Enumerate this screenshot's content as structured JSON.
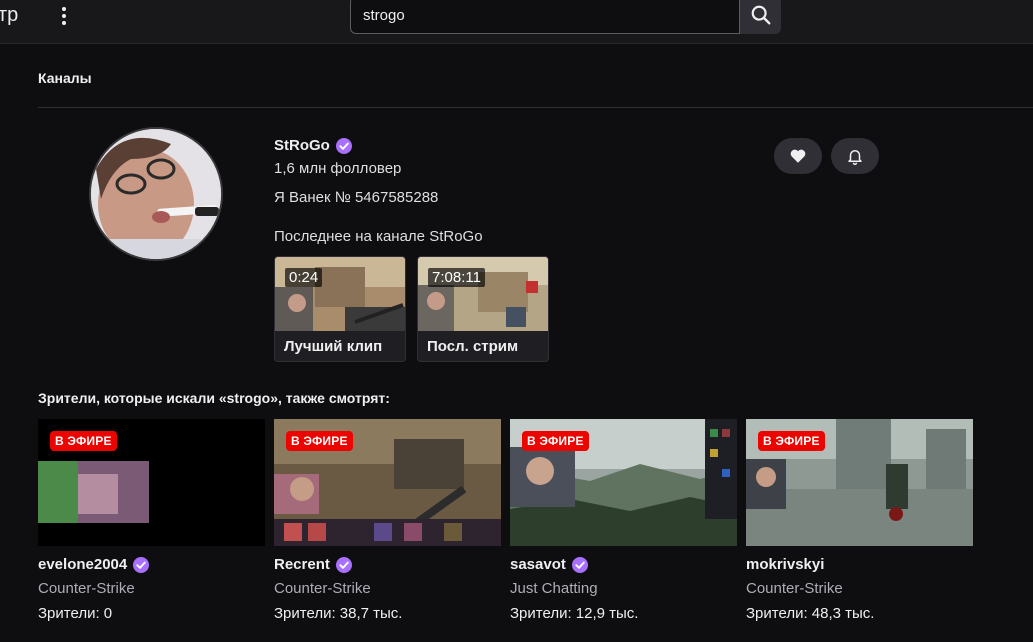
{
  "nav": {
    "partial_text": "тр",
    "search_value": "strogo"
  },
  "channels_section": {
    "title": "Каналы"
  },
  "channel": {
    "name": "StRoGo",
    "followers": "1,6 млн фолловер",
    "description": "Я Ванек № 5467585288",
    "latest_title": "Последнее на канале StRoGo",
    "latest": [
      {
        "badge": "0:24",
        "label": "Лучший клип"
      },
      {
        "badge": "7:08:11",
        "label": "Посл. стрим"
      }
    ]
  },
  "also_watch": {
    "title": "Зрители, которые искали «strogo», также смотрят:",
    "streams": [
      {
        "badge": "В ЭФИРЕ",
        "name": "evelone2004",
        "game": "Counter-Strike",
        "viewers": "Зрители: 0"
      },
      {
        "badge": "В ЭФИРЕ",
        "name": "Recrent",
        "game": "Counter-Strike",
        "viewers": "Зрители: 38,7 тыс."
      },
      {
        "badge": "В ЭФИРЕ",
        "name": "sasavot",
        "game": "Just Chatting",
        "viewers": "Зрители: 12,9 тыс."
      },
      {
        "badge": "В ЭФИРЕ",
        "name": "mokrivskyi",
        "game": "Counter-Strike",
        "viewers": "Зрители: 48,3 тыс."
      }
    ]
  },
  "icons": {
    "search": "search-icon",
    "kebab": "more-vertical-icon",
    "verified": "verified-badge-icon",
    "heart": "heart-icon",
    "bell": "bell-icon"
  },
  "colors": {
    "background": "#0e0e10",
    "accent_verified": "#a970ff",
    "live_red": "#eb0400",
    "secondary_text": "#adadb8"
  }
}
